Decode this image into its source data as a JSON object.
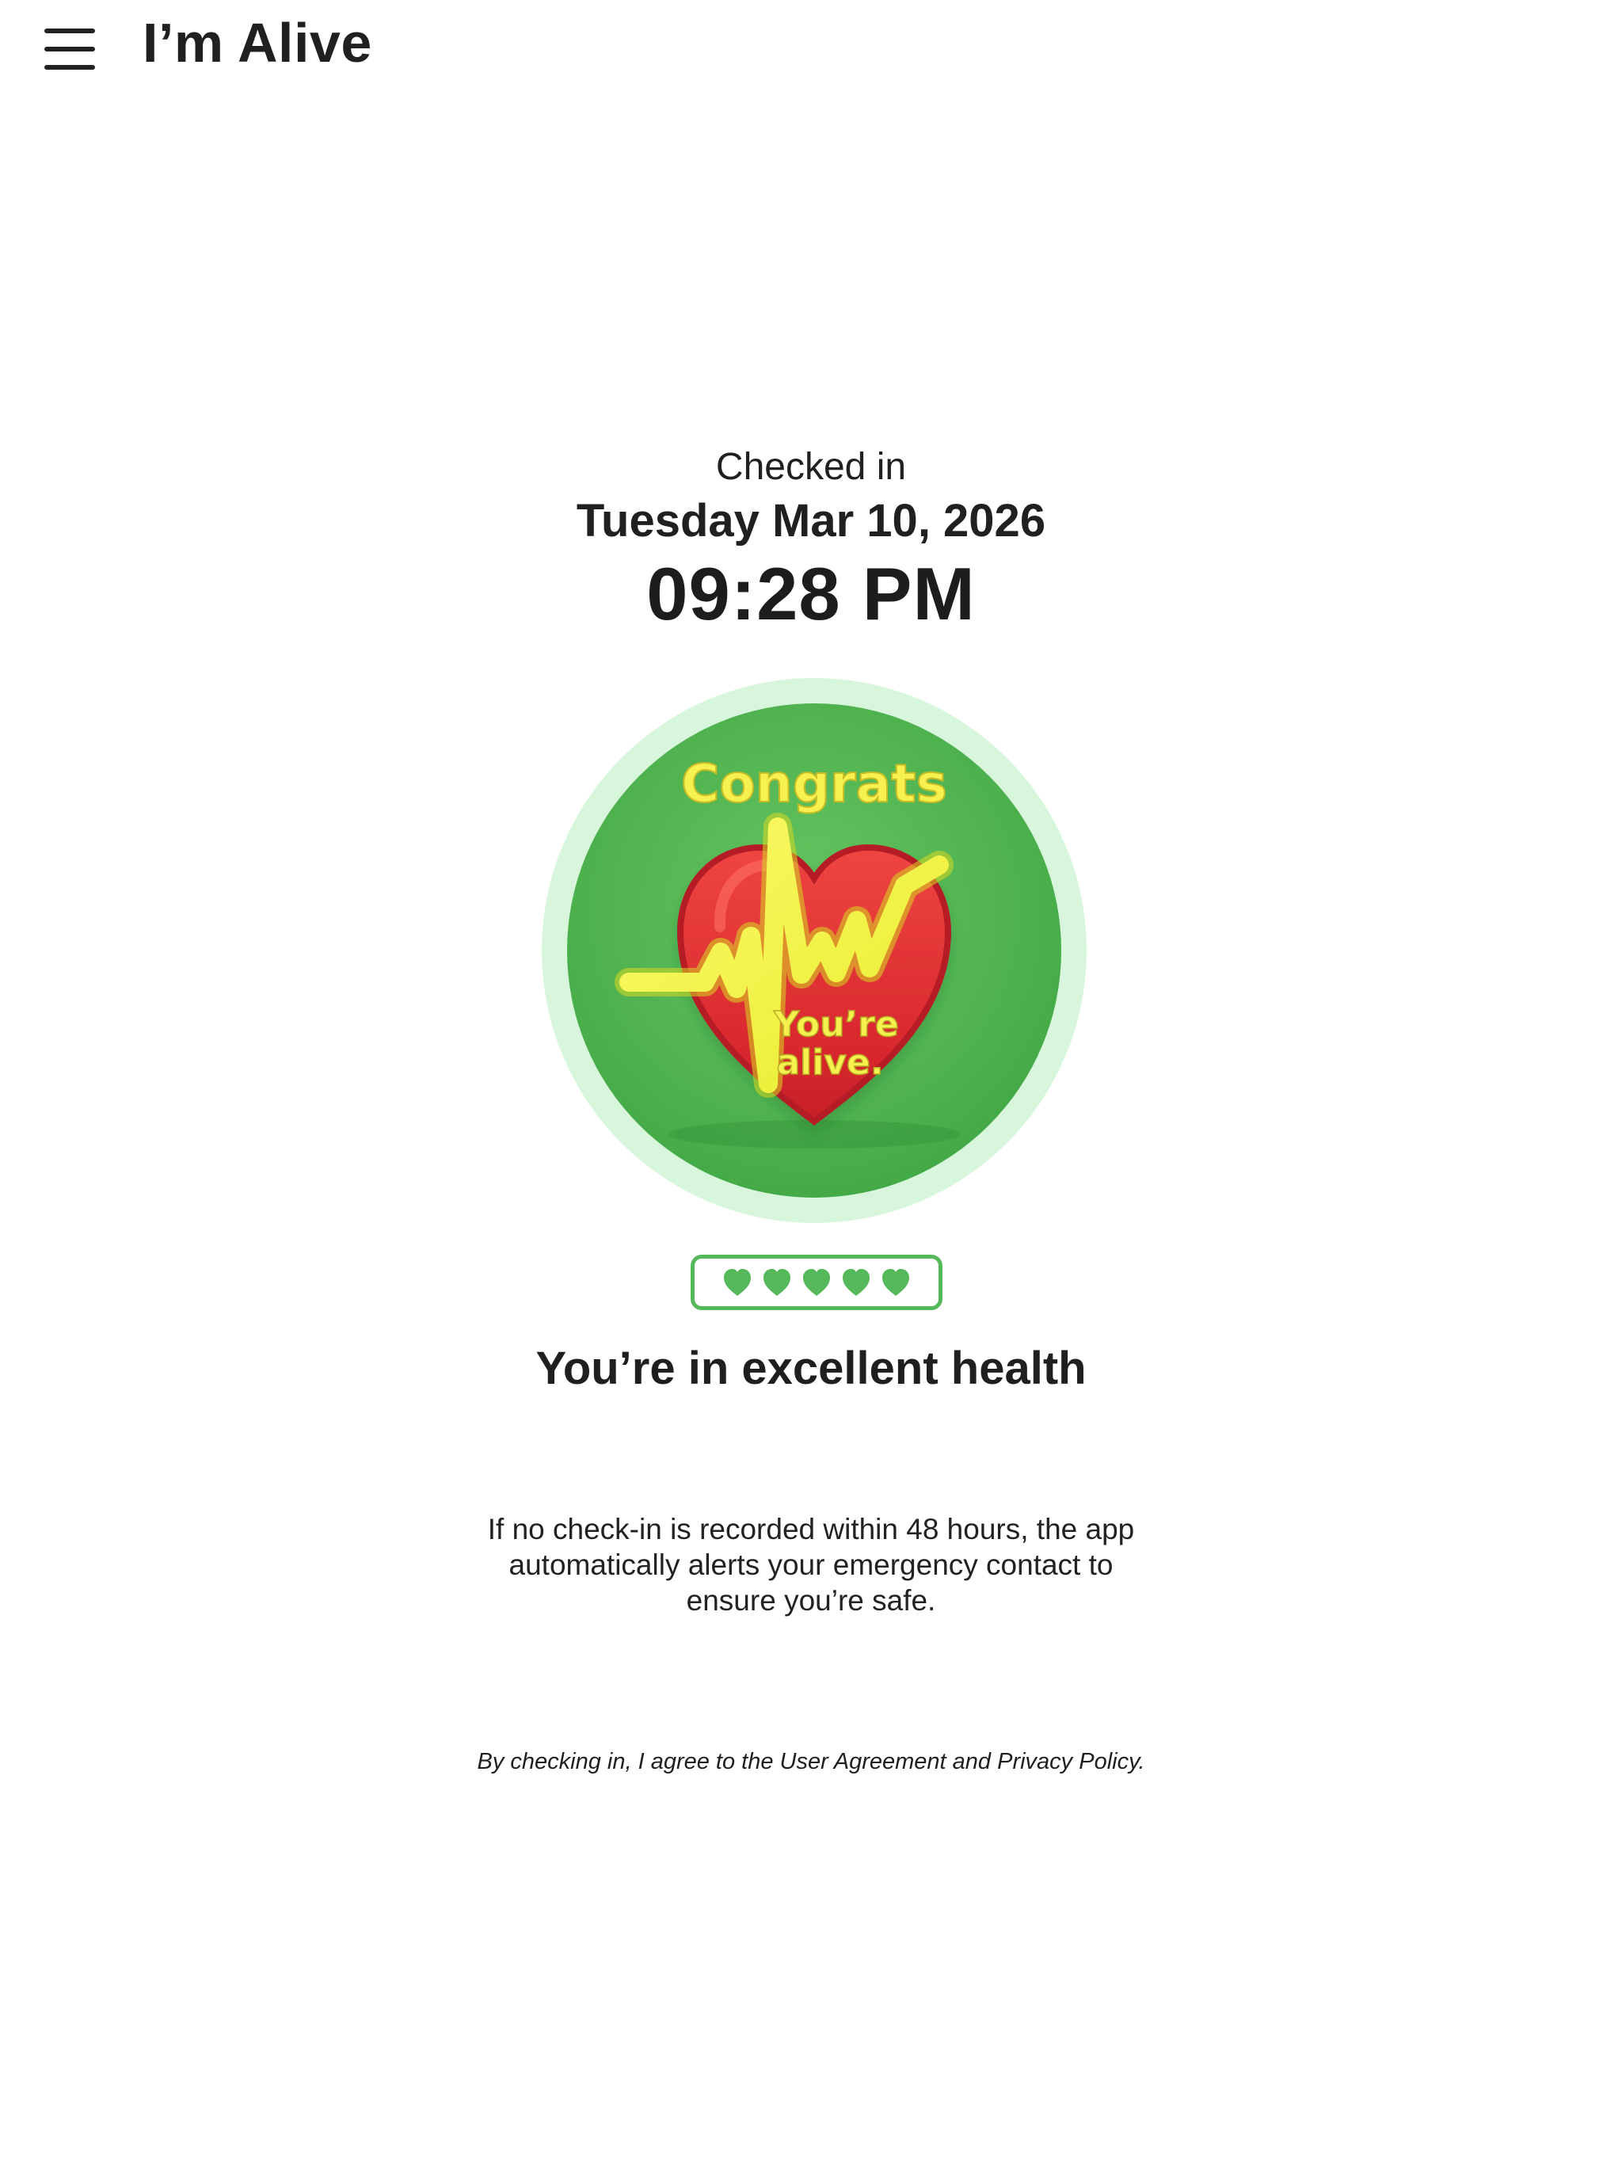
{
  "header": {
    "menu_icon": "hamburger-menu-icon",
    "title": "I’m Alive"
  },
  "checkin": {
    "label": "Checked in",
    "date": "Tuesday Mar 10, 2026",
    "time": "09:28 PM"
  },
  "badge": {
    "icon": "heartbeat-heart-icon",
    "headline": "Congrats",
    "line_1": "You’re",
    "line_2": "alive.",
    "colors": {
      "ring": "#d8f6dc",
      "background": "#53b653",
      "heart": "#d83235",
      "pulse": "#f2f24f",
      "text": "#f7f14f"
    }
  },
  "health": {
    "rating": 5,
    "rating_max": 5,
    "heart_icon": "heart-icon",
    "accent": "#55b85b",
    "status": "You’re in excellent health"
  },
  "info": {
    "line_1": "If no check-in is recorded within 48 hours, the app",
    "line_2": "automatically alerts your emergency contact to",
    "line_3": "ensure you’re safe."
  },
  "legal": {
    "text": "By checking in, I agree to the User Agreement and Privacy Policy."
  }
}
